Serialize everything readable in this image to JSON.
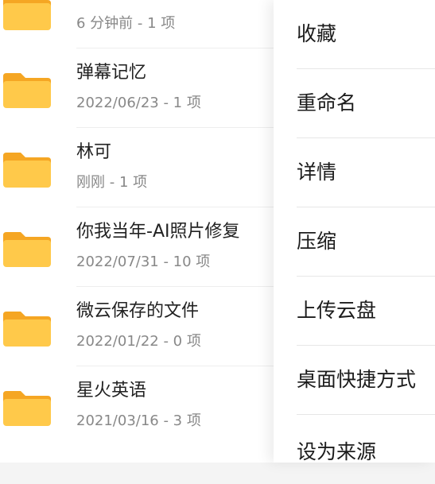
{
  "files": [
    {
      "name": "",
      "meta": "6 分钟前 - 1 项"
    },
    {
      "name": "弹幕记忆",
      "meta": "2022/06/23 - 1 项"
    },
    {
      "name": "林可",
      "meta": "刚刚 - 1 项"
    },
    {
      "name": "你我当年-AI照片修复",
      "meta": "2022/07/31 - 10 项"
    },
    {
      "name": "微云保存的文件",
      "meta": "2022/01/22 - 0 项"
    },
    {
      "name": "星火英语",
      "meta": "2021/03/16 - 3 项"
    }
  ],
  "context_menu": {
    "items": [
      {
        "label": "收藏"
      },
      {
        "label": "重命名"
      },
      {
        "label": "详情"
      },
      {
        "label": "压缩"
      },
      {
        "label": "上传云盘"
      },
      {
        "label": "桌面快捷方式"
      },
      {
        "label": "设为来源"
      }
    ]
  },
  "colors": {
    "folder_body": "#FFC94A",
    "folder_tab": "#F5A623",
    "text_primary": "#222222",
    "text_secondary": "#888888"
  }
}
